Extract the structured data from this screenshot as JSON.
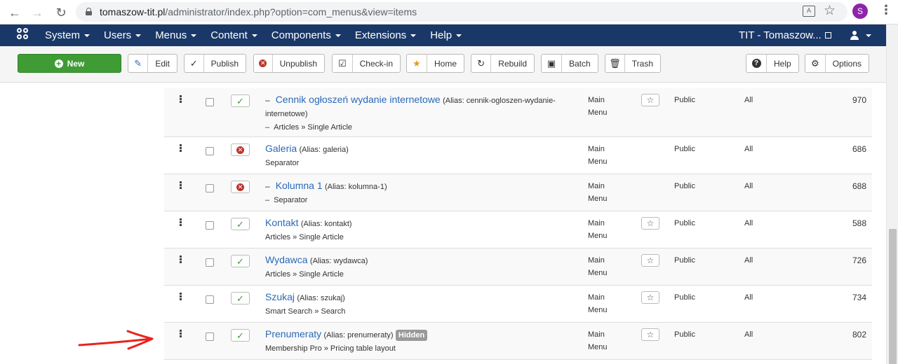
{
  "browser": {
    "url_domain": "tomaszow-tit.pl",
    "url_path": "/administrator/index.php?option=com_menus&view=items",
    "profile_initial": "S"
  },
  "navbar": {
    "menus": [
      "System",
      "Users",
      "Menus",
      "Content",
      "Components",
      "Extensions",
      "Help"
    ],
    "site_name": "TIT - Tomaszow..."
  },
  "toolbar": {
    "new": "New",
    "edit": "Edit",
    "publish": "Publish",
    "unpublish": "Unpublish",
    "checkin": "Check-in",
    "home": "Home",
    "rebuild": "Rebuild",
    "batch": "Batch",
    "trash": "Trash",
    "help": "Help",
    "options": "Options"
  },
  "colors": {
    "navbar": "#1a3867",
    "new_button": "#3f9c35",
    "link": "#2a69b8",
    "published": "#3f9c35",
    "unpublished": "#bd362f",
    "annotation": "#e8231e"
  },
  "rows": [
    {
      "prefix": "–",
      "title": "Cennik ogłoszeń wydanie internetowe",
      "alias_line1": "(Alias: cennik-ogloszen-wydanie-",
      "alias_line2": "internetowe)",
      "type_prefix": "–",
      "type": "Articles » Single Article",
      "status": "published",
      "menu_line1": "Main",
      "menu_line2": "Menu",
      "home": true,
      "access": "Public",
      "language": "All",
      "id": "970"
    },
    {
      "prefix": "",
      "title": "Galeria",
      "alias": "(Alias: galeria)",
      "type_prefix": "",
      "type": "Separator",
      "status": "unpublished",
      "menu_line1": "Main",
      "menu_line2": "Menu",
      "home": false,
      "access": "Public",
      "language": "All",
      "id": "686"
    },
    {
      "prefix": "–",
      "title": "Kolumna 1",
      "alias": "(Alias: kolumna-1)",
      "type_prefix": "–",
      "type": "Separator",
      "status": "unpublished",
      "menu_line1": "Main",
      "menu_line2": "Menu",
      "home": false,
      "access": "Public",
      "language": "All",
      "id": "688"
    },
    {
      "prefix": "",
      "title": "Kontakt",
      "alias": "(Alias: kontakt)",
      "type_prefix": "",
      "type": "Articles » Single Article",
      "status": "published",
      "menu_line1": "Main",
      "menu_line2": "Menu",
      "home": true,
      "access": "Public",
      "language": "All",
      "id": "588"
    },
    {
      "prefix": "",
      "title": "Wydawca",
      "alias": "(Alias: wydawca)",
      "type_prefix": "",
      "type": "Articles » Single Article",
      "status": "published",
      "menu_line1": "Main",
      "menu_line2": "Menu",
      "home": true,
      "access": "Public",
      "language": "All",
      "id": "726"
    },
    {
      "prefix": "",
      "title": "Szukaj",
      "alias": "(Alias: szukaj)",
      "type_prefix": "",
      "type": "Smart Search » Search",
      "status": "published",
      "menu_line1": "Main",
      "menu_line2": "Menu",
      "home": true,
      "access": "Public",
      "language": "All",
      "id": "734"
    },
    {
      "prefix": "",
      "title": "Prenumeraty",
      "alias": "(Alias: prenumeraty)",
      "badge": "Hidden",
      "type_prefix": "",
      "type": "Membership Pro » Pricing table layout",
      "status": "published",
      "menu_line1": "Main",
      "menu_line2": "Menu",
      "home": true,
      "access": "Public",
      "language": "All",
      "id": "802"
    }
  ]
}
